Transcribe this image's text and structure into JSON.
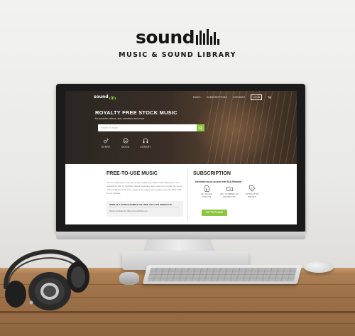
{
  "brand": {
    "word": "sound",
    "tagline": "MUSIC & SOUND LIBRARY"
  },
  "site": {
    "logo_word": "sound",
    "nav": {
      "music": "MUSIC",
      "subscriptions": "SUBSCRIPTIONS",
      "licenses": "LICENSES",
      "login": "LOGIN"
    },
    "hero": {
      "title": "ROYALTY FREE STOCK MUSIC",
      "subtitle": "for youtube videos, ads, websites and more",
      "search_placeholder": "Search for music",
      "categories": [
        "GENRE",
        "MOOD",
        "LIBRARY"
      ]
    },
    "free": {
      "title": "FREE-TO-USE MUSIC",
      "paragraph": "You are welcome to use any of the royalty free stock music tracks from our website for free in YouTube videos, websites, apps and so on under the terms and conditions of the Free License as long as you credit us by including a link to our website.",
      "box_title": "HERE IS A GOOD EXAMPLE OF HOW YOU CAN CREDIT US:",
      "box_text": "Music provided by https://soundhills.com"
    },
    "subscription": {
      "title": "SUBSCRIPTION",
      "note": "Unlimited music access from $14.99/month",
      "features": [
        {
          "label": "ALL MUSIC TRACKS",
          "icon": "music-file-icon"
        },
        {
          "label": "ANY NUMBER OF PRODUCTS",
          "icon": "folder-icon"
        },
        {
          "label": "ATTRACTIVE PRICES",
          "icon": "price-tag-icon"
        }
      ],
      "button": "GO TO PLANS"
    }
  },
  "colors": {
    "accent": "#8dc63f",
    "hero_dark": "#2a2622",
    "text_dark": "#1f1f1f"
  }
}
